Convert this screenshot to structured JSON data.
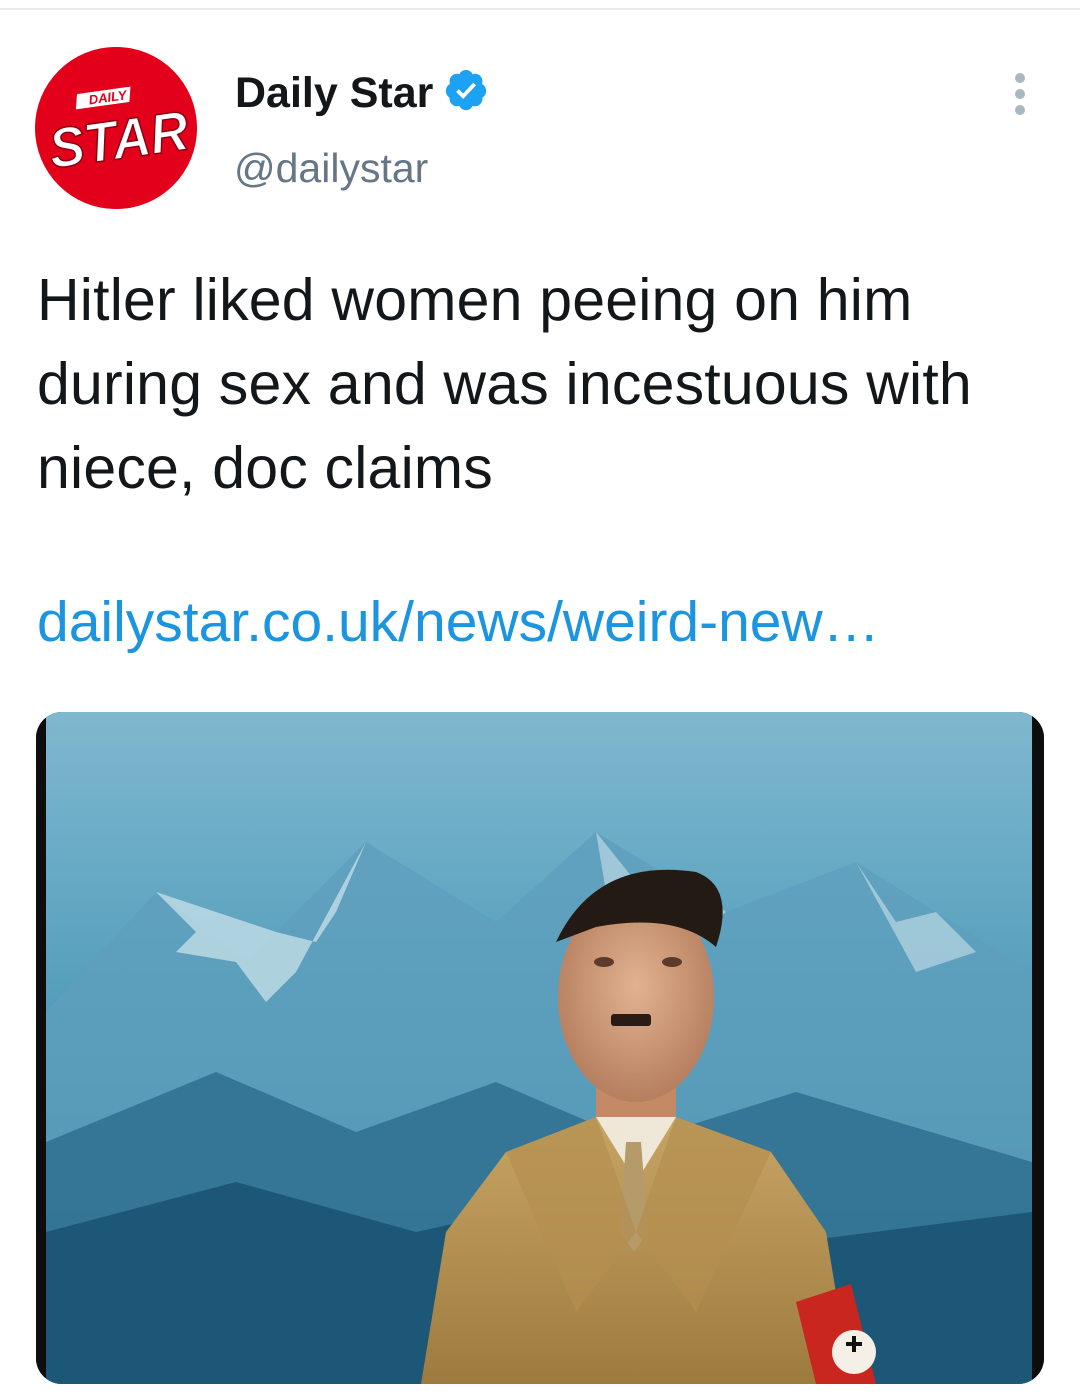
{
  "tweet": {
    "display_name": "Daily Star",
    "handle": "@dailystar",
    "text": "Hitler liked women peeing on him during sex and was incestuous with niece, doc claims",
    "link_text": "dailystar.co.uk/news/weird-new…",
    "verified": true,
    "avatar": {
      "logo_small": "DAILY",
      "logo_large": "STAR",
      "background_color": "#e3001b"
    },
    "more_icon": "more-options-icon",
    "media": {
      "description_icon": "photo"
    }
  },
  "colors": {
    "name": "#14171a",
    "handle": "#657786",
    "link": "#1b95e0",
    "verified": "#1da1f2"
  }
}
